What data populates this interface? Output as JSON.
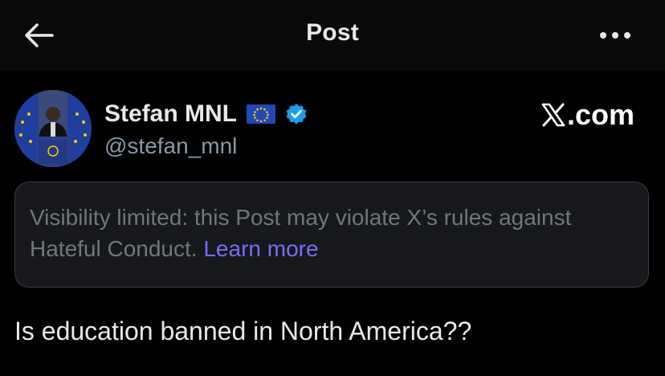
{
  "header": {
    "title": "Post",
    "back_icon": "arrow-left-icon",
    "more_icon": "more-horizontal-icon"
  },
  "author": {
    "display_name": "Stefan MNL",
    "handle": "@stefan_mnl",
    "flag_icon": "eu-flag-icon",
    "verified_icon": "verified-badge-icon",
    "verified_color": "#1d9bf0"
  },
  "watermark": {
    "text": ".com",
    "logo_icon": "x-logo-icon"
  },
  "notice": {
    "text": "Visibility limited: this Post may violate X’s rules against Hateful Conduct.",
    "link_label": "Learn more",
    "link_color": "#7b6cf6"
  },
  "post": {
    "text": "Is education banned in North America??"
  }
}
